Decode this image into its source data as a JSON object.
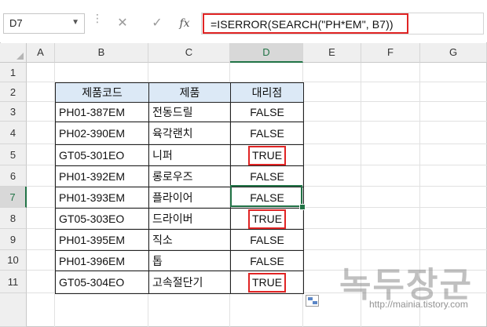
{
  "name_box": {
    "value": "D7"
  },
  "formula_bar": {
    "cancel_icon": "✕",
    "enter_icon": "✓",
    "fx_label": "fx",
    "formula": "=ISERROR(SEARCH(\"PH*EM\", B7))"
  },
  "columns": [
    "A",
    "B",
    "C",
    "D",
    "E",
    "F",
    "G"
  ],
  "rows": [
    "1",
    "2",
    "3",
    "4",
    "5",
    "6",
    "7",
    "8",
    "9",
    "10",
    "11"
  ],
  "table": {
    "headers": [
      "제품코드",
      "제품",
      "대리점"
    ],
    "rows": [
      {
        "code": "PH01-387EM",
        "product": "전동드릴",
        "result": "FALSE"
      },
      {
        "code": "PH02-390EM",
        "product": "육각랜치",
        "result": "FALSE"
      },
      {
        "code": "GT05-301EO",
        "product": "니퍼",
        "result": "TRUE"
      },
      {
        "code": "PH01-392EM",
        "product": "롱로우즈",
        "result": "FALSE"
      },
      {
        "code": "PH01-393EM",
        "product": "플라이어",
        "result": "FALSE"
      },
      {
        "code": "GT05-303EO",
        "product": "드라이버",
        "result": "TRUE"
      },
      {
        "code": "PH01-395EM",
        "product": "직소",
        "result": "FALSE"
      },
      {
        "code": "PH01-396EM",
        "product": "톱",
        "result": "FALSE"
      },
      {
        "code": "GT05-304EO",
        "product": "고속절단기",
        "result": "TRUE"
      }
    ]
  },
  "watermark": {
    "main": "녹두장군",
    "sub": "http://mainia.tistory.com"
  },
  "colors": {
    "accent": "#217346",
    "highlight": "#e02424",
    "header_fill": "#dce9f6"
  }
}
